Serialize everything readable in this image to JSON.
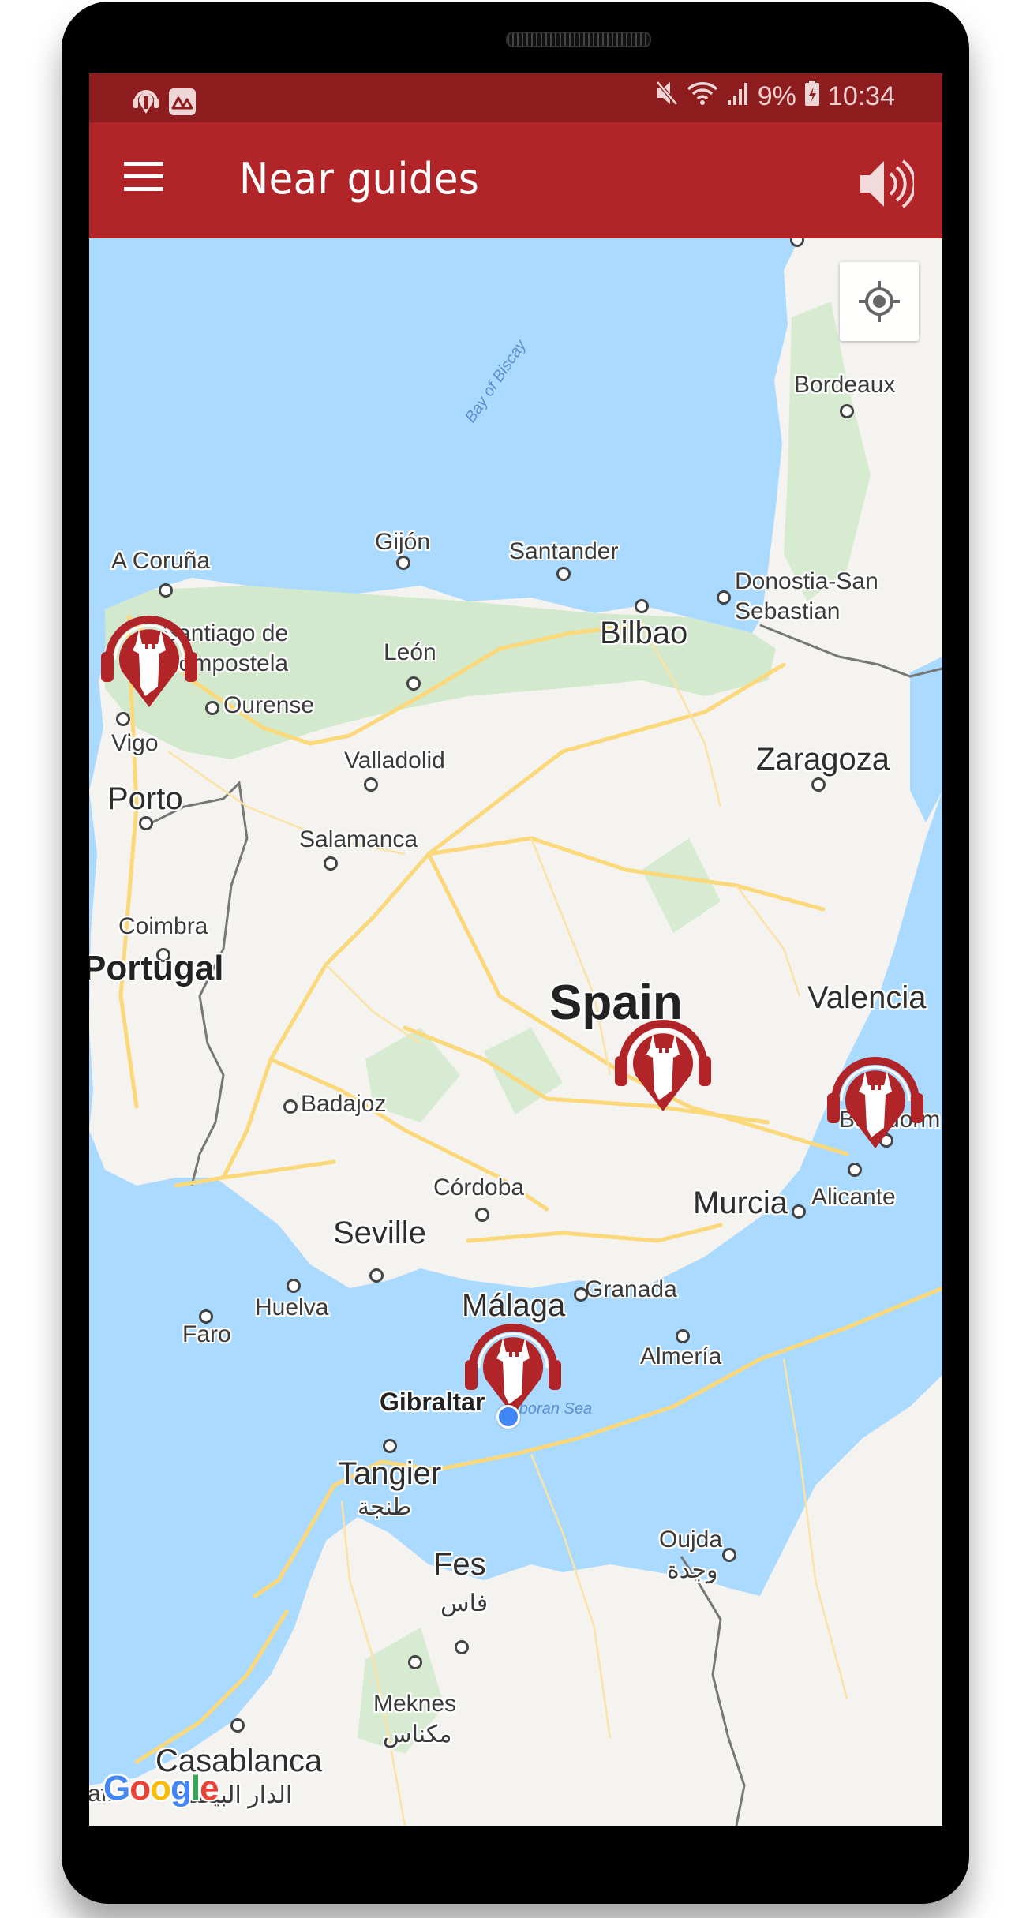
{
  "status_bar": {
    "left_icons": [
      "audio-guide-app-icon",
      "mountain-app-icon"
    ],
    "right_icons": [
      "mute-icon",
      "wifi-icon",
      "signal-icon",
      "battery-charging-icon"
    ],
    "battery": "9%",
    "time": "10:34"
  },
  "toolbar": {
    "menu_icon": "hamburger-menu-icon",
    "title": "Near guides",
    "sound_icon": "volume-icon"
  },
  "map": {
    "attribution": "Google",
    "my_location_button_icon": "crosshair-location-icon",
    "colors": {
      "water": "#aadaff",
      "land": "#f5f3f0",
      "park": "#c8e6c3",
      "road": "#fbd87a",
      "marker": "#b12428",
      "my_location": "#4285f4",
      "app_bar": "#b12428",
      "status_bar": "#8d1d1f"
    },
    "labels": {
      "bay_of_biscay": "Bay of Biscay",
      "bordeaux": "Bordeaux",
      "gijon": "Gijón",
      "santander": "Santander",
      "a_coruna": "A Coruña",
      "donostia": "Donostia-San",
      "sebastian": "Sebastian",
      "santiago1": "Santiago de",
      "santiago2": "Compostela",
      "leon": "León",
      "bilbao": "Bilbao",
      "ourense": "Ourense",
      "vigo": "Vigo",
      "valladolid": "Valladolid",
      "zaragoza": "Zaragoza",
      "porto": "Porto",
      "salamanca": "Salamanca",
      "coimbra": "Coimbra",
      "portugal": "Portugal",
      "spain": "Spain",
      "valencia": "Valencia",
      "badajoz": "Badajoz",
      "benidorm": "Benidorm",
      "cordoba": "Córdoba",
      "murcia": "Murcia",
      "alicante": "Alicante",
      "seville": "Seville",
      "granada": "Granada",
      "huelva": "Huelva",
      "malaga": "Málaga",
      "faro": "Faro",
      "almeria": "Almería",
      "gibraltar": "Gibraltar",
      "alboran_sea": "Alboran Sea",
      "tangier": "Tangier",
      "tangier_ar": "طنجة",
      "oujda": "Oujda",
      "oujda_ar": "وجدة",
      "fes": "Fes",
      "fes_ar": "فاس",
      "meknes": "Meknes",
      "meknes_ar": "مكناس",
      "casablanca": "Casablanca",
      "casablanca_ar": "الدار البيضاء",
      "safi": "afi"
    },
    "guide_markers": [
      {
        "name": "Santiago de Compostela guide"
      },
      {
        "name": "Madrid guide"
      },
      {
        "name": "Valencia guide"
      },
      {
        "name": "Málaga guide"
      }
    ]
  }
}
